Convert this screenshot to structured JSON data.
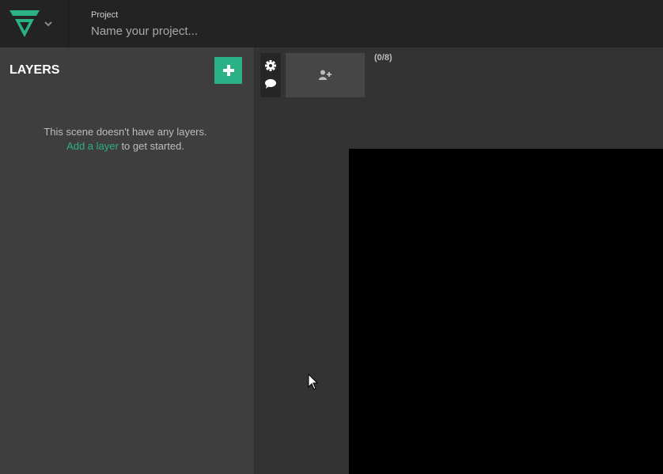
{
  "header": {
    "project_label": "Project",
    "project_placeholder": "Name your project...",
    "project_value": ""
  },
  "layers": {
    "title": "LAYERS",
    "empty_line1": "This scene doesn't have any layers.",
    "add_link": "Add a layer",
    "empty_line2_suffix": " to get started."
  },
  "guests": {
    "count": "(0/8)"
  },
  "icons": {
    "logo": "brand-logo-icon",
    "menu": "chevron-down-icon",
    "add": "plus-icon",
    "settings": "gear-icon",
    "chat": "chat-bubble-icon",
    "add_guest": "user-plus-icon",
    "cursor": "mouse-pointer-icon"
  },
  "colors": {
    "accent": "#2bb185",
    "topbar": "#232323",
    "panel": "#3e3e3e",
    "stage": "#333333",
    "canvas": "#000000"
  }
}
